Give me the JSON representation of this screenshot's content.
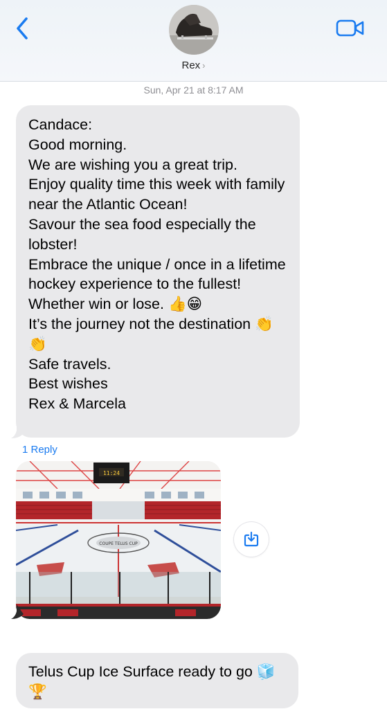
{
  "header": {
    "contact_name": "Rex",
    "chevron": "›",
    "back_icon": "chevron-left-icon",
    "video_icon": "video-camera-icon",
    "accent_color": "#1a7bf0"
  },
  "thread": {
    "timestamp": "Sun, Apr 21 at 8:17 AM",
    "messages": [
      {
        "text": "Candace:\nGood morning.\nWe are wishing you a great trip.\nEnjoy quality time this week with family near the Atlantic Ocean!\nSavour the sea food especially the lobster!\nEmbrace the unique / once in a lifetime hockey experience to the fullest! Whether win or lose. 👍😁\nIt’s the journey not the destination 👏👏\nSafe travels.\nBest wishes\nRex & Marcela",
        "reply_label": "1 Reply"
      },
      {
        "type": "photo",
        "description": "hockey arena ice surface",
        "action_icon": "save-download-icon"
      },
      {
        "text": "Telus Cup Ice Surface ready to go 🧊🏆"
      }
    ]
  },
  "photo_scene": {
    "scoreboard": "11:24",
    "center_logo": "COUPE TELUS CUP"
  }
}
